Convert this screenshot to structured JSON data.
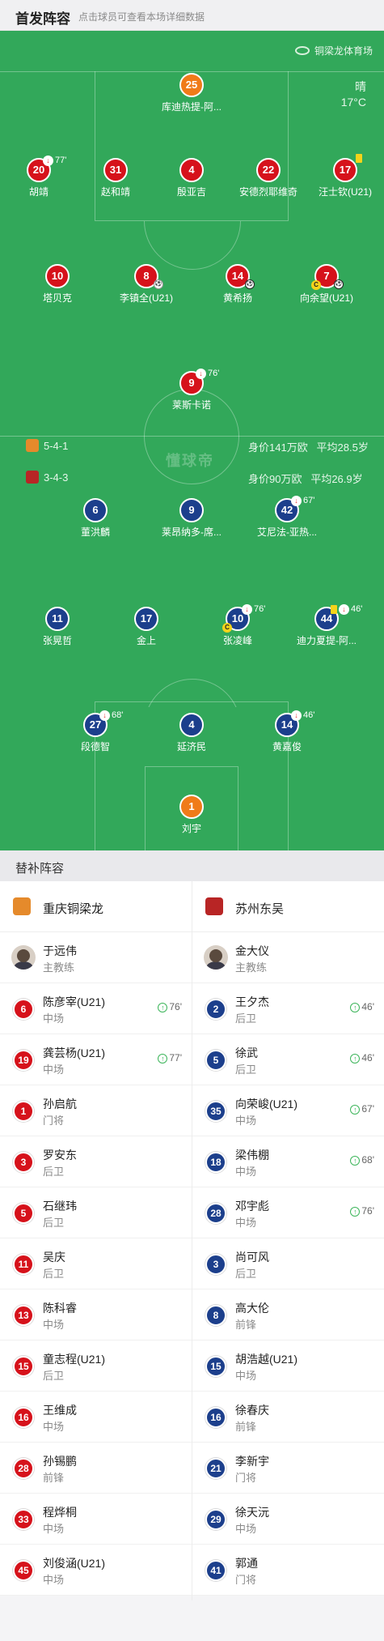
{
  "header": {
    "title": "首发阵容",
    "subtitle": "点击球员可查看本场详细数据"
  },
  "venue": "铜梁龙体育场",
  "weather": {
    "condition": "晴",
    "temp": "17°C"
  },
  "watermark": "懂球帝",
  "home_info": {
    "formation": "5-4-1",
    "value": "身价141万欧",
    "age": "平均28.5岁"
  },
  "away_info": {
    "formation": "3-4-3",
    "value": "身价90万欧",
    "age": "平均26.9岁"
  },
  "home_lineup": [
    {
      "num": "25",
      "name": "库迪热提-阿...",
      "gk": true
    },
    {
      "num": "20",
      "name": "胡靖",
      "sub": "77'"
    },
    {
      "num": "31",
      "name": "赵和靖"
    },
    {
      "num": "4",
      "name": "殷亚吉"
    },
    {
      "num": "22",
      "name": "安德烈耶维奇"
    },
    {
      "num": "17",
      "name": "汪士钦(U21)"
    },
    {
      "num": "10",
      "name": "塔贝克"
    },
    {
      "num": "8",
      "name": "李镇全(U21)"
    },
    {
      "num": "14",
      "name": "黄希扬"
    },
    {
      "num": "7",
      "name": "向余望(U21)"
    },
    {
      "num": "9",
      "name": "莱斯卡诺",
      "sub": "76'"
    }
  ],
  "away_lineup": [
    {
      "num": "6",
      "name": "董洪麟"
    },
    {
      "num": "9",
      "name": "莱昂纳多-席..."
    },
    {
      "num": "42",
      "name": "艾尼法-亚热...",
      "sub": "67'"
    },
    {
      "num": "11",
      "name": "张晃哲"
    },
    {
      "num": "17",
      "name": "金上"
    },
    {
      "num": "10",
      "name": "张凌峰",
      "sub": "76'"
    },
    {
      "num": "44",
      "name": "迪力夏提-阿...",
      "sub": "46'"
    },
    {
      "num": "27",
      "name": "段德智",
      "sub": "68'"
    },
    {
      "num": "4",
      "name": "延济民"
    },
    {
      "num": "14",
      "name": "黄嘉俊",
      "sub": "46'"
    },
    {
      "num": "1",
      "name": "刘宇",
      "gk": true
    }
  ],
  "subs_title": "替补阵容",
  "home_team": "重庆铜梁龙",
  "away_team": "苏州东吴",
  "home_coach": {
    "name": "于远伟",
    "role": "主教练"
  },
  "away_coach": {
    "name": "金大仪",
    "role": "主教练"
  },
  "home_subs": [
    {
      "num": "6",
      "name": "陈彦宰(U21)",
      "pos": "中场",
      "in": "76'"
    },
    {
      "num": "19",
      "name": "龚芸杨(U21)",
      "pos": "中场",
      "in": "77'"
    },
    {
      "num": "1",
      "name": "孙启航",
      "pos": "门将"
    },
    {
      "num": "3",
      "name": "罗安东",
      "pos": "后卫"
    },
    {
      "num": "5",
      "name": "石继玮",
      "pos": "后卫"
    },
    {
      "num": "11",
      "name": "吴庆",
      "pos": "后卫"
    },
    {
      "num": "13",
      "name": "陈科睿",
      "pos": "中场"
    },
    {
      "num": "15",
      "name": "童志程(U21)",
      "pos": "后卫"
    },
    {
      "num": "16",
      "name": "王维成",
      "pos": "中场"
    },
    {
      "num": "28",
      "name": "孙锡鹏",
      "pos": "前锋"
    },
    {
      "num": "33",
      "name": "程烨桐",
      "pos": "中场"
    },
    {
      "num": "45",
      "name": "刘俊涵(U21)",
      "pos": "中场"
    }
  ],
  "away_subs": [
    {
      "num": "2",
      "name": "王夕杰",
      "pos": "后卫",
      "in": "46'"
    },
    {
      "num": "5",
      "name": "徐武",
      "pos": "后卫",
      "in": "46'"
    },
    {
      "num": "35",
      "name": "向荣峻(U21)",
      "pos": "中场",
      "in": "67'"
    },
    {
      "num": "18",
      "name": "梁伟棚",
      "pos": "中场",
      "in": "68'"
    },
    {
      "num": "28",
      "name": "邓宇彪",
      "pos": "中场",
      "in": "76'"
    },
    {
      "num": "3",
      "name": "尚可风",
      "pos": "后卫"
    },
    {
      "num": "8",
      "name": "高大伦",
      "pos": "前锋"
    },
    {
      "num": "15",
      "name": "胡浩越(U21)",
      "pos": "中场"
    },
    {
      "num": "16",
      "name": "徐春庆",
      "pos": "前锋"
    },
    {
      "num": "21",
      "name": "李新宇",
      "pos": "门将"
    },
    {
      "num": "29",
      "name": "徐天沅",
      "pos": "中场"
    },
    {
      "num": "41",
      "name": "郭通",
      "pos": "门将"
    }
  ],
  "colors": {
    "home": "#d6121b",
    "away": "#1c3f8c",
    "gk": "#f07b19",
    "pitch": "#32a85a"
  }
}
